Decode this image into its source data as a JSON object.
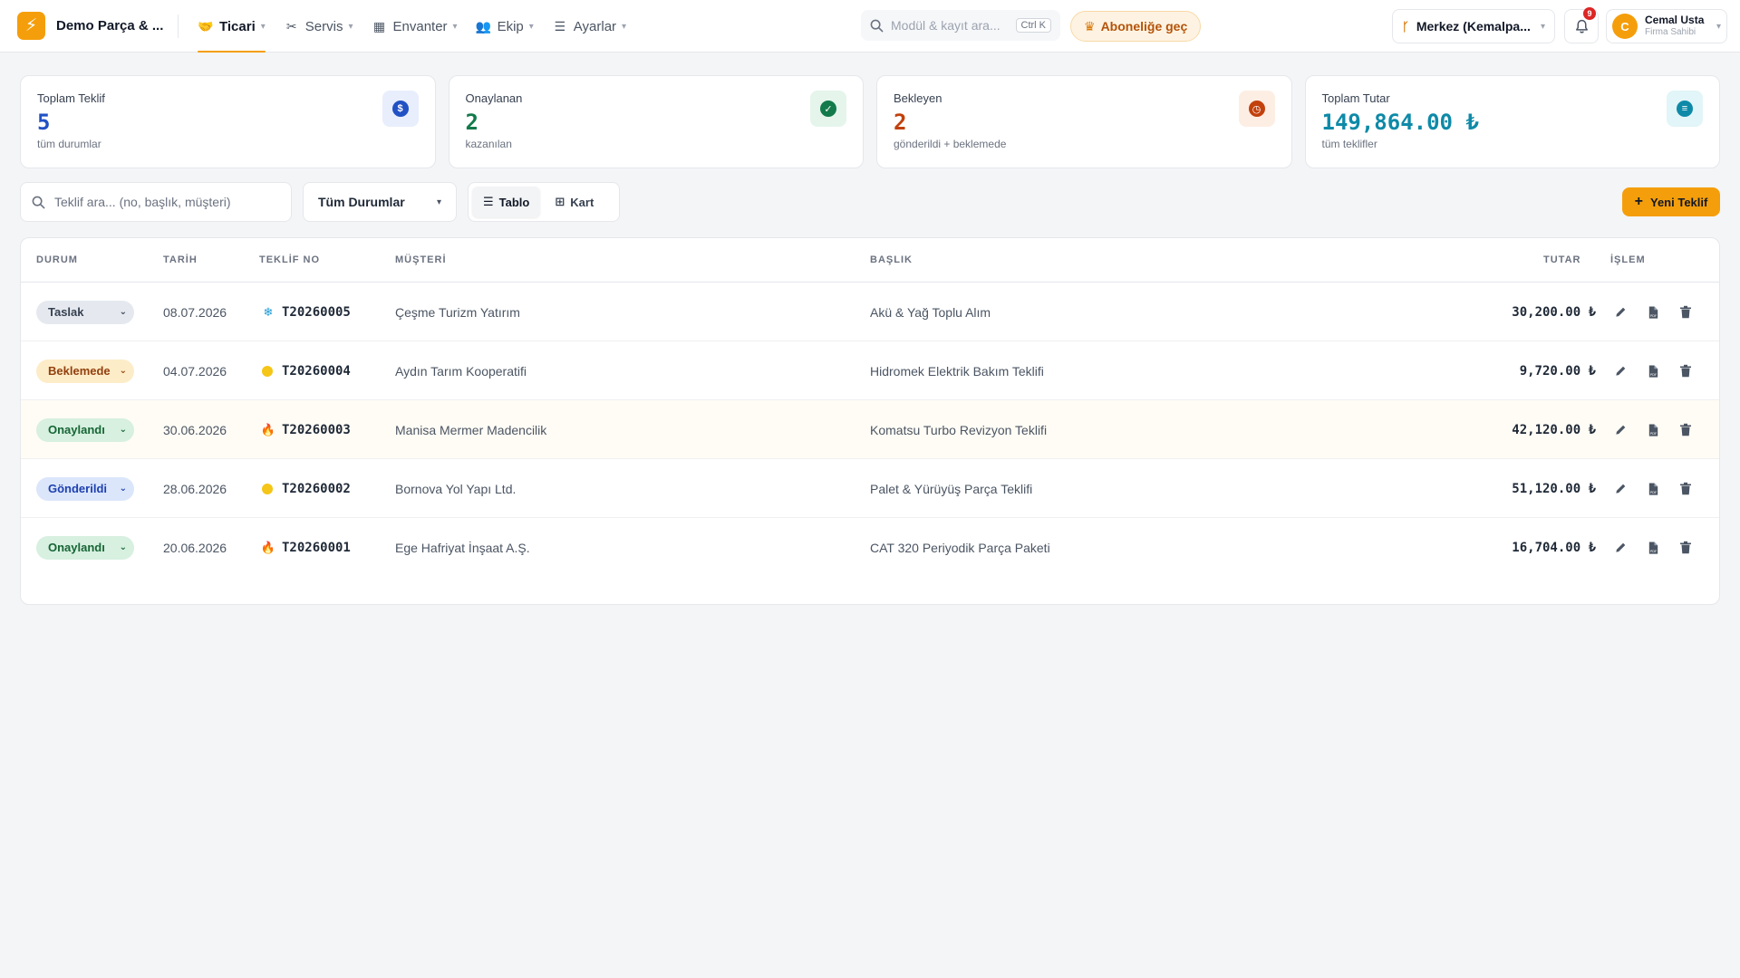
{
  "brand": {
    "name": "Demo Parça & ..."
  },
  "nav": [
    {
      "label": "Ticari",
      "icon": "handshake-icon",
      "active": true
    },
    {
      "label": "Servis",
      "icon": "tools-icon",
      "active": false
    },
    {
      "label": "Envanter",
      "icon": "warehouse-icon",
      "active": false
    },
    {
      "label": "Ekip",
      "icon": "team-icon",
      "active": false
    },
    {
      "label": "Ayarlar",
      "icon": "sliders-icon",
      "active": false
    }
  ],
  "top_search": {
    "placeholder": "Modül & kayıt ara...",
    "shortcut": "Ctrl K"
  },
  "upgrade": {
    "label": "Aboneliğe geç"
  },
  "branch": {
    "label": "Merkez (Kemalpa..."
  },
  "notifications": {
    "count": "9"
  },
  "user": {
    "initial": "C",
    "name": "Cemal Usta",
    "role": "Firma Sahibi"
  },
  "stats": [
    {
      "label": "Toplam Teklif",
      "value": "5",
      "sub": "tüm durumlar",
      "color": "#2151c4",
      "icon_bg": "#e8eefc",
      "icon": "document-dollar-icon",
      "glyph": "$"
    },
    {
      "label": "Onaylanan",
      "value": "2",
      "sub": "kazanılan",
      "color": "#137a4b",
      "icon_bg": "#e5f5ec",
      "icon": "check-circle-icon",
      "glyph": "✓"
    },
    {
      "label": "Bekleyen",
      "value": "2",
      "sub": "gönderildi + beklemede",
      "color": "#c2410c",
      "icon_bg": "#fdeee4",
      "icon": "clock-icon",
      "glyph": "◷"
    },
    {
      "label": "Toplam Tutar",
      "value": "149,864.00 ₺",
      "sub": "tüm teklifler",
      "color": "#0e8aa8",
      "icon_bg": "#e2f5f8",
      "icon": "coins-icon",
      "glyph": "≡"
    }
  ],
  "toolbar": {
    "search_placeholder": "Teklif ara... (no, başlık, müşteri)",
    "status_filter": "Tüm Durumlar",
    "view_table": "Tablo",
    "view_card": "Kart",
    "new_button": "Yeni Teklif"
  },
  "table": {
    "headers": [
      "DURUM",
      "TARİH",
      "TEKLİF NO",
      "MÜŞTERİ",
      "BAŞLIK",
      "TUTAR",
      "İŞLEM"
    ],
    "rows": [
      {
        "status": "Taslak",
        "date": "08.07.2026",
        "no": "T20260005",
        "priority": "snowflake",
        "customer": "Çeşme Turizm Yatırım",
        "title": "Akü & Yağ Toplu Alım",
        "amount": "30,200.00 ₺"
      },
      {
        "status": "Beklemede",
        "date": "04.07.2026",
        "no": "T20260004",
        "priority": "dot",
        "customer": "Aydın Tarım Kooperatifi",
        "title": "Hidromek Elektrik Bakım Teklifi",
        "amount": "9,720.00 ₺"
      },
      {
        "status": "Onaylandı",
        "date": "30.06.2026",
        "no": "T20260003",
        "priority": "flame",
        "customer": "Manisa Mermer Madencilik",
        "title": "Komatsu Turbo Revizyon Teklifi",
        "amount": "42,120.00 ₺"
      },
      {
        "status": "Gönderildi",
        "date": "28.06.2026",
        "no": "T20260002",
        "priority": "dot",
        "customer": "Bornova Yol Yapı Ltd.",
        "title": "Palet & Yürüyüş Parça Teklifi",
        "amount": "51,120.00 ₺"
      },
      {
        "status": "Onaylandı",
        "date": "20.06.2026",
        "no": "T20260001",
        "priority": "flame",
        "customer": "Ege Hafriyat İnşaat A.Ş.",
        "title": "CAT 320 Periyodik Parça Paketi",
        "amount": "16,704.00 ₺"
      }
    ]
  },
  "status_styles": {
    "Taslak": {
      "bg": "#e5e9ef",
      "fg": "#374151"
    },
    "Beklemede": {
      "bg": "#fdecc8",
      "fg": "#92400e"
    },
    "Onaylandı": {
      "bg": "#d7f0e0",
      "fg": "#166534"
    },
    "Gönderildi": {
      "bg": "#dbe6fb",
      "fg": "#1e40af"
    }
  },
  "priority_styles": {
    "snowflake": {
      "glyph": "❄",
      "color": "#1a9ad6"
    },
    "dot": {
      "glyph": "",
      "color": "#f5c518"
    },
    "flame": {
      "glyph": "🔥",
      "color": "#ea580c"
    }
  }
}
